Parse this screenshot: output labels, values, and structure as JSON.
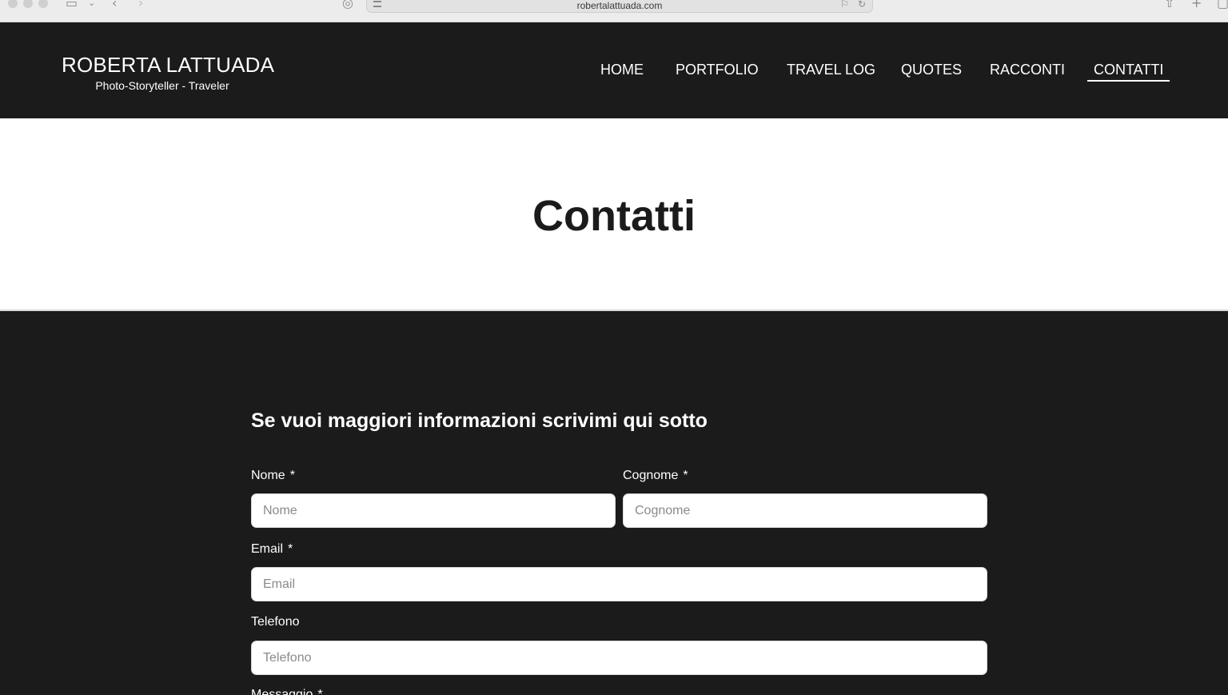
{
  "browser": {
    "url": "robertalattuada.com"
  },
  "site": {
    "title": "ROBERTA LATTUADA",
    "subtitle": "Photo-Storyteller - Traveler"
  },
  "nav": {
    "items": [
      "HOME",
      "PORTFOLIO",
      "TRAVEL LOG",
      "QUOTES",
      "RACCONTI",
      "CONTATTI"
    ],
    "active": "CONTATTI"
  },
  "page": {
    "title": "Contatti"
  },
  "form": {
    "heading": "Se vuoi maggiori informazioni scrivimi qui sotto",
    "required_marker": "*",
    "fields": {
      "nome": {
        "label": "Nome",
        "placeholder": "Nome"
      },
      "cognome": {
        "label": "Cognome",
        "placeholder": "Cognome"
      },
      "email": {
        "label": "Email",
        "placeholder": "Email"
      },
      "telefono": {
        "label": "Telefono",
        "placeholder": "Telefono"
      },
      "messaggio": {
        "label": "Messaggio"
      }
    }
  },
  "colors": {
    "header_bg": "#1b1b1b",
    "title_band_bg": "#ffffff",
    "text_light": "#ffffff",
    "text_dark": "#1b1b1b"
  }
}
